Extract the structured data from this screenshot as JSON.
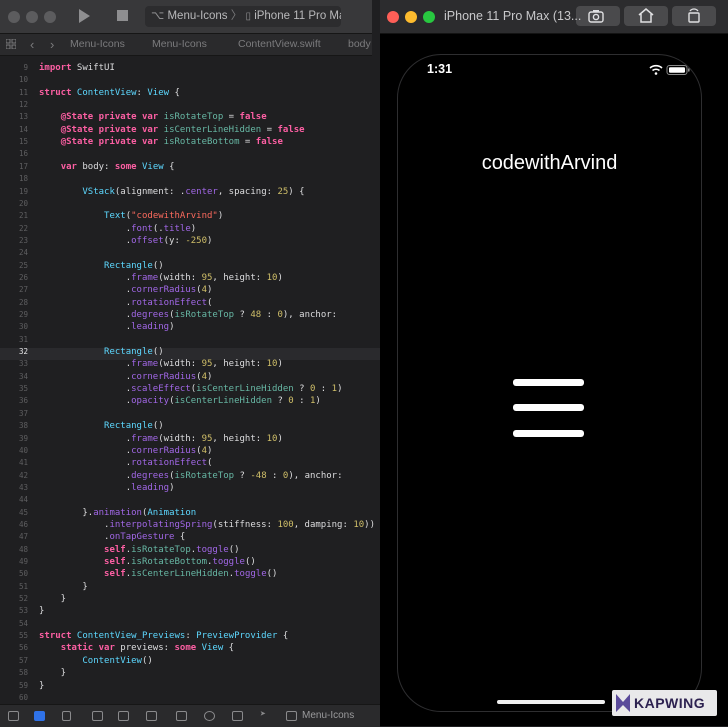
{
  "xcode": {
    "scheme": "Menu-Icons",
    "device": "iPhone 11 Pro Max",
    "breadcrumb": [
      "Menu-Icons",
      "Menu-Icons",
      "ContentView.swift",
      "body"
    ],
    "active_line": "32",
    "code_lines": [
      {
        "n": "9",
        "t": [
          [
            "kw",
            "import"
          ],
          [
            "pl",
            " SwiftUI"
          ]
        ]
      },
      {
        "n": "10",
        "t": []
      },
      {
        "n": "11",
        "t": [
          [
            "kw",
            "struct"
          ],
          [
            "ty",
            " ContentView"
          ],
          [
            "pl",
            ": "
          ],
          [
            "ty",
            "View"
          ],
          [
            "pl",
            " {"
          ]
        ]
      },
      {
        "n": "12",
        "t": []
      },
      {
        "n": "13",
        "t": [
          [
            "pl",
            "    "
          ],
          [
            "kw",
            "@State private var"
          ],
          [
            "pr",
            " isRotateTop"
          ],
          [
            "pl",
            " = "
          ],
          [
            "kw",
            "false"
          ]
        ]
      },
      {
        "n": "14",
        "t": [
          [
            "pl",
            "    "
          ],
          [
            "kw",
            "@State private var"
          ],
          [
            "pr",
            " isCenterLineHidden"
          ],
          [
            "pl",
            " = "
          ],
          [
            "kw",
            "false"
          ]
        ]
      },
      {
        "n": "15",
        "t": [
          [
            "pl",
            "    "
          ],
          [
            "kw",
            "@State private var"
          ],
          [
            "pr",
            " isRotateBottom"
          ],
          [
            "pl",
            " = "
          ],
          [
            "kw",
            "false"
          ]
        ]
      },
      {
        "n": "16",
        "t": []
      },
      {
        "n": "17",
        "t": [
          [
            "pl",
            "    "
          ],
          [
            "kw",
            "var"
          ],
          [
            "pl",
            " body: "
          ],
          [
            "kw",
            "some"
          ],
          [
            "ty",
            " View"
          ],
          [
            "pl",
            " {"
          ]
        ]
      },
      {
        "n": "18",
        "t": []
      },
      {
        "n": "19",
        "t": [
          [
            "pl",
            "        "
          ],
          [
            "ty",
            "VStack"
          ],
          [
            "pl",
            "(alignment: ."
          ],
          [
            "fn",
            "center"
          ],
          [
            "pl",
            ", spacing: "
          ],
          [
            "nm",
            "25"
          ],
          [
            "pl",
            ") {"
          ]
        ]
      },
      {
        "n": "20",
        "t": []
      },
      {
        "n": "21",
        "t": [
          [
            "pl",
            "            "
          ],
          [
            "ty",
            "Text"
          ],
          [
            "pl",
            "("
          ],
          [
            "st",
            "\"codewithArvind\""
          ],
          [
            "pl",
            ")"
          ]
        ]
      },
      {
        "n": "22",
        "t": [
          [
            "pl",
            "                ."
          ],
          [
            "fn",
            "font"
          ],
          [
            "pl",
            "(."
          ],
          [
            "fn",
            "title"
          ],
          [
            "pl",
            ")"
          ]
        ]
      },
      {
        "n": "23",
        "t": [
          [
            "pl",
            "                ."
          ],
          [
            "fn",
            "offset"
          ],
          [
            "pl",
            "(y: "
          ],
          [
            "nm",
            "-250"
          ],
          [
            "pl",
            ")"
          ]
        ]
      },
      {
        "n": "24",
        "t": []
      },
      {
        "n": "25",
        "t": [
          [
            "pl",
            "            "
          ],
          [
            "ty",
            "Rectangle"
          ],
          [
            "pl",
            "()"
          ]
        ]
      },
      {
        "n": "26",
        "t": [
          [
            "pl",
            "                ."
          ],
          [
            "fn",
            "frame"
          ],
          [
            "pl",
            "(width: "
          ],
          [
            "nm",
            "95"
          ],
          [
            "pl",
            ", height: "
          ],
          [
            "nm",
            "10"
          ],
          [
            "pl",
            ")"
          ]
        ]
      },
      {
        "n": "27",
        "t": [
          [
            "pl",
            "                ."
          ],
          [
            "fn",
            "cornerRadius"
          ],
          [
            "pl",
            "("
          ],
          [
            "nm",
            "4"
          ],
          [
            "pl",
            ")"
          ]
        ]
      },
      {
        "n": "28",
        "t": [
          [
            "pl",
            "                ."
          ],
          [
            "fn",
            "rotationEffect"
          ],
          [
            "pl",
            "("
          ]
        ]
      },
      {
        "n": "29",
        "t": [
          [
            "pl",
            "                ."
          ],
          [
            "fn",
            "degrees"
          ],
          [
            "pl",
            "("
          ],
          [
            "pr",
            "isRotateTop"
          ],
          [
            "pl",
            " ? "
          ],
          [
            "nm",
            "48"
          ],
          [
            "pl",
            " : "
          ],
          [
            "nm",
            "0"
          ],
          [
            "pl",
            "), anchor:"
          ]
        ]
      },
      {
        "n": "30",
        "t": [
          [
            "pl",
            "                ."
          ],
          [
            "fn",
            "leading"
          ],
          [
            "pl",
            ")"
          ]
        ]
      },
      {
        "n": "31",
        "t": []
      },
      {
        "n": "32",
        "t": [
          [
            "pl",
            "            "
          ],
          [
            "ty",
            "Rectangle"
          ],
          [
            "pl",
            "()"
          ]
        ]
      },
      {
        "n": "33",
        "t": [
          [
            "pl",
            "                ."
          ],
          [
            "fn",
            "frame"
          ],
          [
            "pl",
            "(width: "
          ],
          [
            "nm",
            "95"
          ],
          [
            "pl",
            ", height: "
          ],
          [
            "nm",
            "10"
          ],
          [
            "pl",
            ")"
          ]
        ]
      },
      {
        "n": "34",
        "t": [
          [
            "pl",
            "                ."
          ],
          [
            "fn",
            "cornerRadius"
          ],
          [
            "pl",
            "("
          ],
          [
            "nm",
            "4"
          ],
          [
            "pl",
            ")"
          ]
        ]
      },
      {
        "n": "35",
        "t": [
          [
            "pl",
            "                ."
          ],
          [
            "fn",
            "scaleEffect"
          ],
          [
            "pl",
            "("
          ],
          [
            "pr",
            "isCenterLineHidden"
          ],
          [
            "pl",
            " ? "
          ],
          [
            "nm",
            "0"
          ],
          [
            "pl",
            " : "
          ],
          [
            "nm",
            "1"
          ],
          [
            "pl",
            ")"
          ]
        ]
      },
      {
        "n": "36",
        "t": [
          [
            "pl",
            "                ."
          ],
          [
            "fn",
            "opacity"
          ],
          [
            "pl",
            "("
          ],
          [
            "pr",
            "isCenterLineHidden"
          ],
          [
            "pl",
            " ? "
          ],
          [
            "nm",
            "0"
          ],
          [
            "pl",
            " : "
          ],
          [
            "nm",
            "1"
          ],
          [
            "pl",
            ")"
          ]
        ]
      },
      {
        "n": "37",
        "t": []
      },
      {
        "n": "38",
        "t": [
          [
            "pl",
            "            "
          ],
          [
            "ty",
            "Rectangle"
          ],
          [
            "pl",
            "()"
          ]
        ]
      },
      {
        "n": "39",
        "t": [
          [
            "pl",
            "                ."
          ],
          [
            "fn",
            "frame"
          ],
          [
            "pl",
            "(width: "
          ],
          [
            "nm",
            "95"
          ],
          [
            "pl",
            ", height: "
          ],
          [
            "nm",
            "10"
          ],
          [
            "pl",
            ")"
          ]
        ]
      },
      {
        "n": "40",
        "t": [
          [
            "pl",
            "                ."
          ],
          [
            "fn",
            "cornerRadius"
          ],
          [
            "pl",
            "("
          ],
          [
            "nm",
            "4"
          ],
          [
            "pl",
            ")"
          ]
        ]
      },
      {
        "n": "41",
        "t": [
          [
            "pl",
            "                ."
          ],
          [
            "fn",
            "rotationEffect"
          ],
          [
            "pl",
            "("
          ]
        ]
      },
      {
        "n": "42",
        "t": [
          [
            "pl",
            "                ."
          ],
          [
            "fn",
            "degrees"
          ],
          [
            "pl",
            "("
          ],
          [
            "pr",
            "isRotateTop"
          ],
          [
            "pl",
            " ? "
          ],
          [
            "nm",
            "-48"
          ],
          [
            "pl",
            " : "
          ],
          [
            "nm",
            "0"
          ],
          [
            "pl",
            "), anchor:"
          ]
        ]
      },
      {
        "n": "43",
        "t": [
          [
            "pl",
            "                ."
          ],
          [
            "fn",
            "leading"
          ],
          [
            "pl",
            ")"
          ]
        ]
      },
      {
        "n": "44",
        "t": []
      },
      {
        "n": "45",
        "t": [
          [
            "pl",
            "        }."
          ],
          [
            "fn",
            "animation"
          ],
          [
            "pl",
            "("
          ],
          [
            "ty",
            "Animation"
          ]
        ]
      },
      {
        "n": "46",
        "t": [
          [
            "pl",
            "            ."
          ],
          [
            "fn",
            "interpolatingSpring"
          ],
          [
            "pl",
            "(stiffness: "
          ],
          [
            "nm",
            "100"
          ],
          [
            "pl",
            ", damping: "
          ],
          [
            "nm",
            "10"
          ],
          [
            "pl",
            "))"
          ]
        ]
      },
      {
        "n": "47",
        "t": [
          [
            "pl",
            "            ."
          ],
          [
            "fn",
            "onTapGesture"
          ],
          [
            "pl",
            " {"
          ]
        ]
      },
      {
        "n": "48",
        "t": [
          [
            "pl",
            "            "
          ],
          [
            "kw",
            "self"
          ],
          [
            "pl",
            "."
          ],
          [
            "pr",
            "isRotateTop"
          ],
          [
            "pl",
            "."
          ],
          [
            "fn",
            "toggle"
          ],
          [
            "pl",
            "()"
          ]
        ]
      },
      {
        "n": "49",
        "t": [
          [
            "pl",
            "            "
          ],
          [
            "kw",
            "self"
          ],
          [
            "pl",
            "."
          ],
          [
            "pr",
            "isRotateBottom"
          ],
          [
            "pl",
            "."
          ],
          [
            "fn",
            "toggle"
          ],
          [
            "pl",
            "()"
          ]
        ]
      },
      {
        "n": "50",
        "t": [
          [
            "pl",
            "            "
          ],
          [
            "kw",
            "self"
          ],
          [
            "pl",
            "."
          ],
          [
            "pr",
            "isCenterLineHidden"
          ],
          [
            "pl",
            "."
          ],
          [
            "fn",
            "toggle"
          ],
          [
            "pl",
            "()"
          ]
        ]
      },
      {
        "n": "51",
        "t": [
          [
            "pl",
            "        }"
          ]
        ]
      },
      {
        "n": "52",
        "t": [
          [
            "pl",
            "    }"
          ]
        ]
      },
      {
        "n": "53",
        "t": [
          [
            "pl",
            "}"
          ]
        ]
      },
      {
        "n": "54",
        "t": []
      },
      {
        "n": "55",
        "t": [
          [
            "kw",
            "struct"
          ],
          [
            "ty",
            " ContentView_Previews"
          ],
          [
            "pl",
            ": "
          ],
          [
            "ty",
            "PreviewProvider"
          ],
          [
            "pl",
            " {"
          ]
        ]
      },
      {
        "n": "56",
        "t": [
          [
            "pl",
            "    "
          ],
          [
            "kw",
            "static var"
          ],
          [
            "pl",
            " previews: "
          ],
          [
            "kw",
            "some"
          ],
          [
            "ty",
            " View"
          ],
          [
            "pl",
            " {"
          ]
        ]
      },
      {
        "n": "57",
        "t": [
          [
            "pl",
            "        "
          ],
          [
            "ty",
            "ContentView"
          ],
          [
            "pl",
            "()"
          ]
        ]
      },
      {
        "n": "58",
        "t": [
          [
            "pl",
            "    }"
          ]
        ]
      },
      {
        "n": "59",
        "t": [
          [
            "pl",
            "}"
          ]
        ]
      },
      {
        "n": "60",
        "t": []
      }
    ],
    "bottom_label": "Menu-Icons"
  },
  "simulator": {
    "window_title": "iPhone 11 Pro Max (13...",
    "status_time": "1:31",
    "app_title": "codewithArvind",
    "menu_lines": 3
  },
  "watermark": "KAPWING",
  "colors": {
    "keyword": "#fc5fa3",
    "type": "#5dd8ff",
    "property": "#67b7a4",
    "function": "#a167e6",
    "string": "#fc6a5d",
    "number": "#d0bf69"
  }
}
